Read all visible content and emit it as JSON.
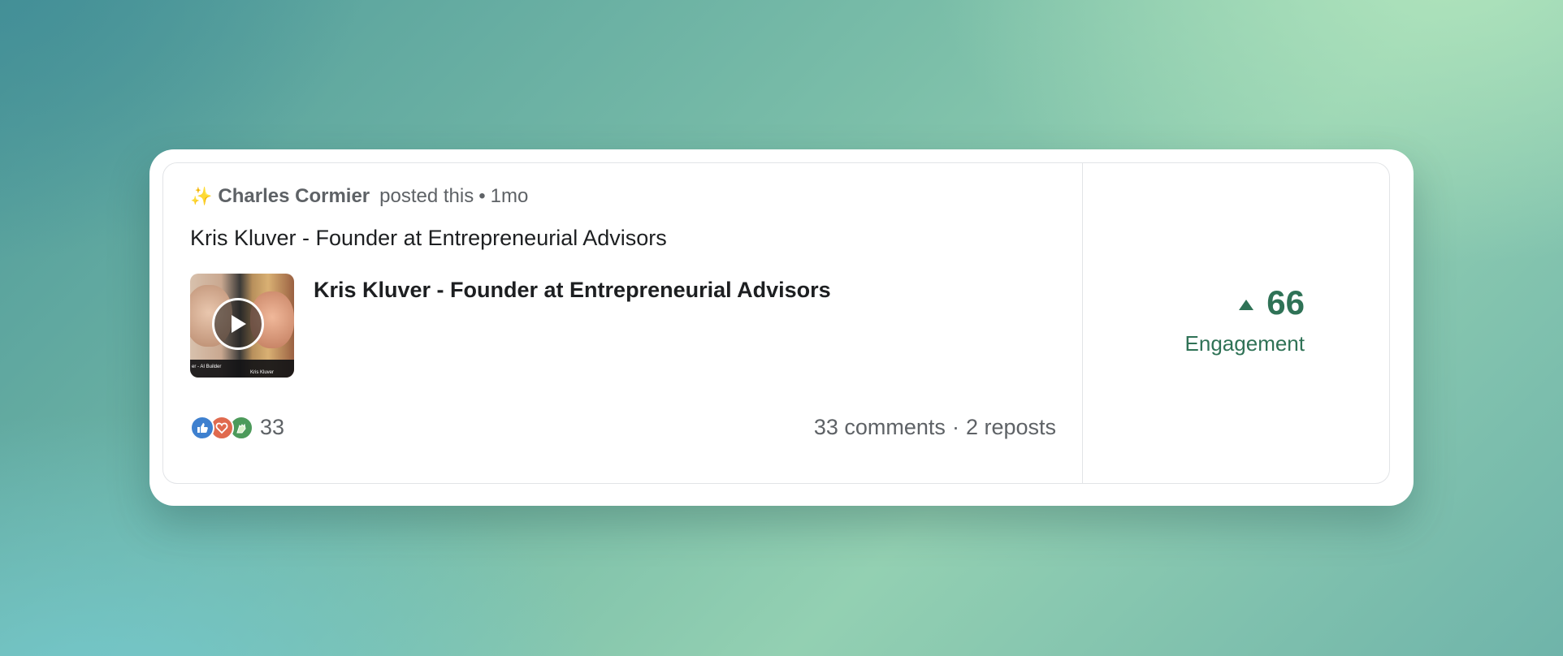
{
  "post": {
    "author": "Charles Cormier",
    "action": "posted this",
    "separator": "•",
    "age": "1mo",
    "text": "Kris Kluver - Founder at Entrepreneurial Advisors",
    "attachment": {
      "title": "Kris Kluver - Founder at Entrepreneurial Advisors",
      "thumb_caption_left": "er - AI Builder",
      "thumb_caption_right": "Kris Kluver"
    },
    "reactions": {
      "icons": [
        "like-icon",
        "love-icon",
        "celebrate-icon"
      ],
      "count": "33"
    },
    "comments": "33 comments",
    "dot": "·",
    "reposts": "2 reposts"
  },
  "metric": {
    "value": "66",
    "label": "Engagement",
    "trend": "up",
    "color": "#2f7256"
  }
}
